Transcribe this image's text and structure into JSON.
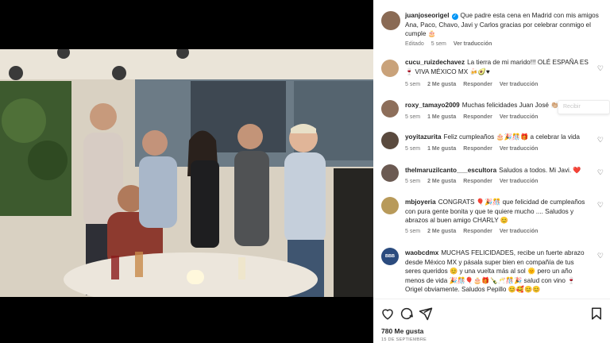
{
  "post": {
    "username": "juanjoseorigel",
    "caption": "Que padre esta cena en Madrid con mis amigos Ana, Paco, Chavo, Javi y Carlos gracias por celebrar conmigo el cumple 🎂",
    "edited": "Editado",
    "time": "5 sem",
    "see_translation": "Ver traducción",
    "likes": "780 Me gusta",
    "date": "15 DE SEPTIEMBRE"
  },
  "comments": [
    {
      "username": "cucu_ruizdechavez",
      "text": "La tierra de mi marido!!! OLÉ ESPAÑA ES 🍷 VIVA MÉXICO MX 🍻🥑♥",
      "time": "5 sem",
      "likes": "2 Me gusta",
      "reply": "Responder",
      "translate": "Ver traducción",
      "avatar_color": "#c9a27a"
    },
    {
      "username": "roxy_tamayo2009",
      "text": "Muchas felicidades Juan José 👏🏼👏🏼",
      "time": "5 sem",
      "likes": "1 Me gusta",
      "reply": "Responder",
      "translate": "Ver traducción",
      "avatar_color": "#8d6e5a"
    },
    {
      "username": "yoyitazurita",
      "text": "Feliz cumpleaños 🎂🎉🎊🎁 a celebrar la vida",
      "time": "5 sem",
      "likes": "1 Me gusta",
      "reply": "Responder",
      "translate": "Ver traducción",
      "avatar_color": "#5a4a3e"
    },
    {
      "username": "thelmaruzilcanto___escultora",
      "text": "Saludos a todos. Mi Javi. ❤️",
      "time": "5 sem",
      "likes": "2 Me gusta",
      "reply": "Responder",
      "translate": "Ver traducción",
      "avatar_color": "#6b5a52"
    },
    {
      "username": "mbjoyeria",
      "text": "CONGRATS 🎈🎉🎊 que felicidad de cumpleaños con pura gente bonita y que te quiere mucho .... Saludos y abrazos al buen amigo CHARLY 😊",
      "time": "5 sem",
      "likes": "2 Me gusta",
      "reply": "Responder",
      "translate": "Ver traducción",
      "avatar_color": "#b89a5a"
    },
    {
      "username": "waobcdmx",
      "text": "MUCHAS FELICIDADES, recibe un fuerte abrazo desde México MX y pásala super bien en compañía de tus seres queridos 😊 y una vuelta más al sol 🌞 pero un año menos de vida 🎉🎊🎈🎂🎁🍾🥂🎊🎉 salud con vino 🍷 Origel obviamente. Saludos Pepillo 😊🥰😊😊",
      "time": "",
      "likes": "",
      "reply": "",
      "translate": "",
      "avatar_color": "#2b4b7e",
      "avatar_text": "BBB"
    }
  ],
  "tooltip": "Recibir",
  "colors": {
    "verified": "#0095f6",
    "meta": "#737373",
    "text": "#262626"
  }
}
